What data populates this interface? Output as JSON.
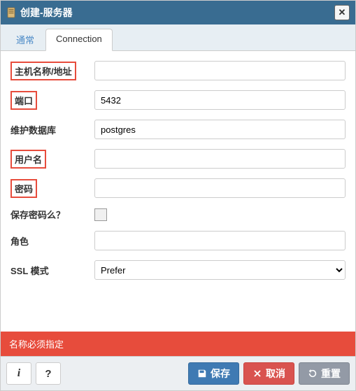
{
  "dialog": {
    "title": "创建-服务器"
  },
  "tabs": {
    "t0": "通常",
    "t1": "Connection"
  },
  "form": {
    "host_label": "主机名称/地址",
    "host_value": "",
    "port_label": "端口",
    "port_value": "5432",
    "maintdb_label": "维护数据库",
    "maintdb_value": "postgres",
    "user_label": "用户名",
    "user_value": "",
    "pwd_label": "密码",
    "pwd_value": "",
    "savepwd_label": "保存密码么？",
    "role_label": "角色",
    "role_value": "",
    "sslmode_label": "SSL 模式",
    "sslmode_value": "Prefer"
  },
  "error": {
    "message": "名称必须指定"
  },
  "buttons": {
    "info": "i",
    "help": "?",
    "save": "保存",
    "cancel": "取消",
    "reset": "重置"
  }
}
